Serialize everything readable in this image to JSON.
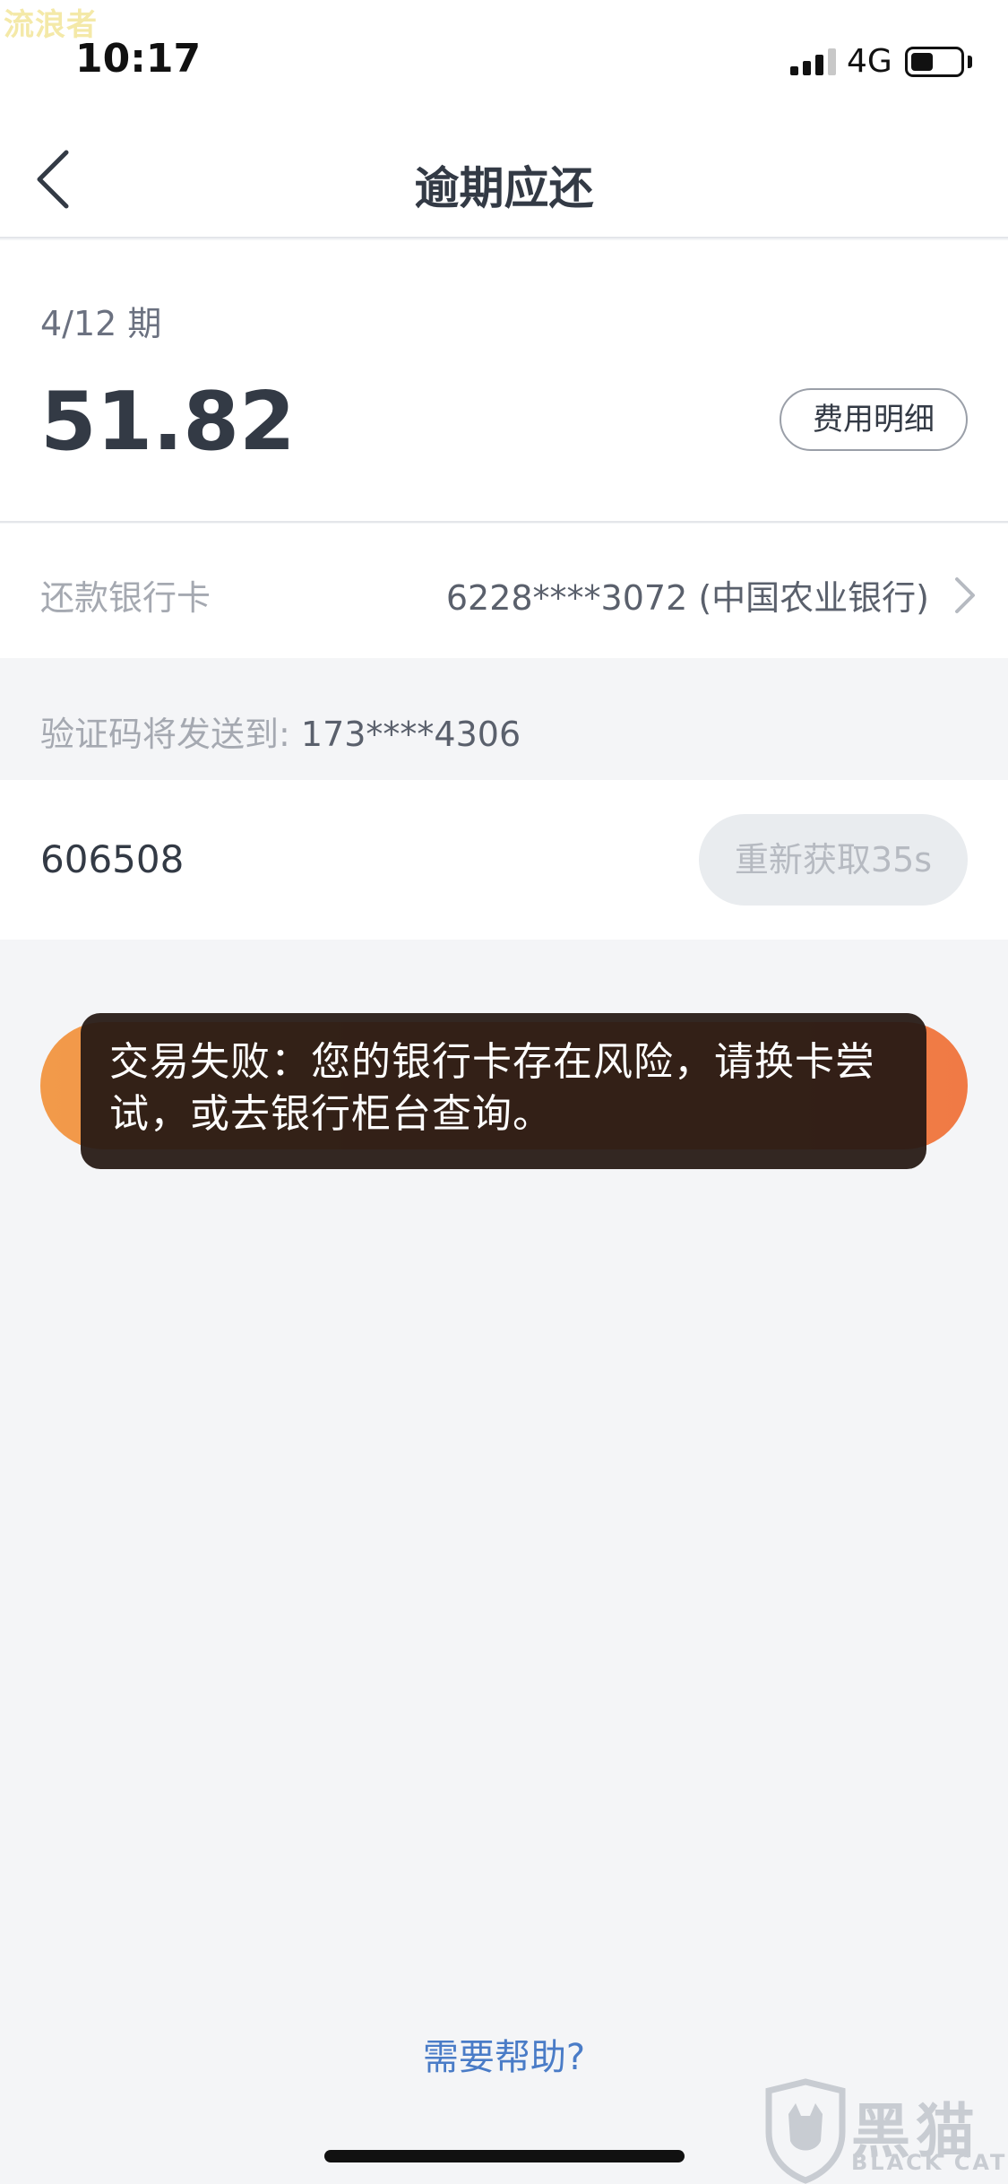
{
  "status_bar": {
    "watermark": "流浪者",
    "time": "10:17",
    "network": "4G",
    "signal_bars_active": 3,
    "signal_bars_total": 4,
    "battery_level": 0.45
  },
  "nav": {
    "title": "逾期应还",
    "back_icon": "chevron-left-icon"
  },
  "bill": {
    "period": "4/12 期",
    "amount": "51.82",
    "fee_detail_label": "费用明细"
  },
  "bank_card": {
    "label": "还款银行卡",
    "value": "6228****3072 (中国农业银行)",
    "chevron_icon": "chevron-right-icon"
  },
  "sms": {
    "hint_label": "验证码将发送到:",
    "phone": "173****4306"
  },
  "code": {
    "value": "606508",
    "resend_label": "重新获取35s"
  },
  "toast": {
    "message": "交易失败：您的银行卡存在风险，请换卡尝试，或去银行柜台查询。"
  },
  "help": {
    "label": "需要帮助?"
  },
  "watermark_logo": {
    "text": "黑猫",
    "subtext": "BLACK CAT"
  },
  "colors": {
    "accent_orange": "#f07a45",
    "link_blue": "#4a7cc7",
    "toast_bg": "#261a14"
  }
}
